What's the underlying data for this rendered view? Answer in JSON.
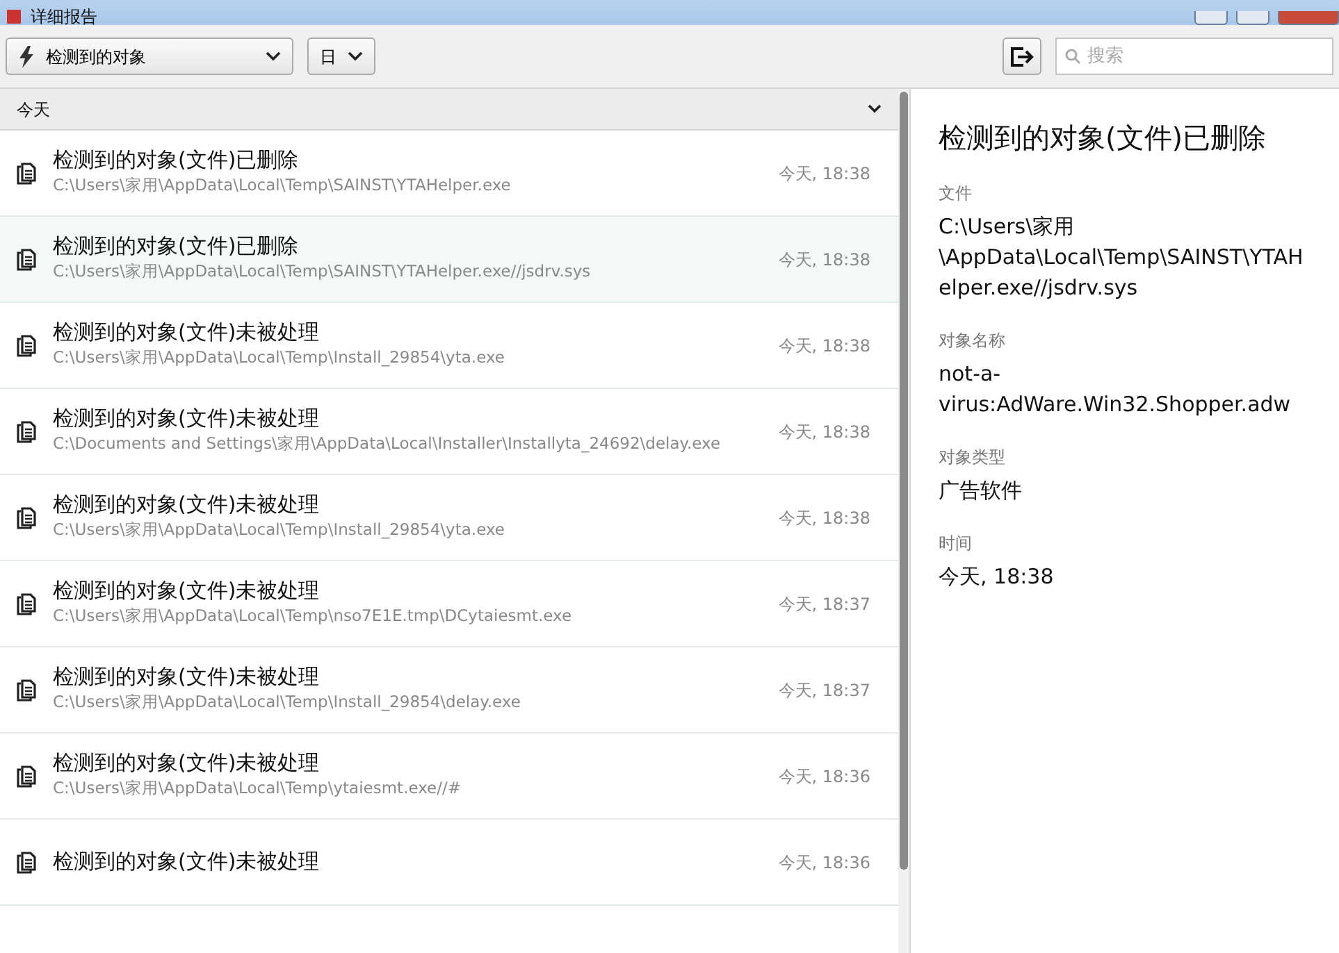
{
  "window": {
    "title": "详细报告"
  },
  "toolbar": {
    "filter": "检测到的对象",
    "period": "日",
    "search": {
      "placeholder": "搜索"
    }
  },
  "list": {
    "group": "今天",
    "expanded": true,
    "items": [
      {
        "title": "检测到的对象(文件)已删除",
        "path": "C:\\Users\\家用\\AppData\\Local\\Temp\\SAINST\\YTAHelper.exe",
        "time": "今天, 18:38",
        "selected": false
      },
      {
        "title": "检测到的对象(文件)已删除",
        "path": "C:\\Users\\家用\\AppData\\Local\\Temp\\SAINST\\YTAHelper.exe//jsdrv.sys",
        "time": "今天, 18:38",
        "selected": true
      },
      {
        "title": "检测到的对象(文件)未被处理",
        "path": "C:\\Users\\家用\\AppData\\Local\\Temp\\Install_29854\\yta.exe",
        "time": "今天, 18:38",
        "selected": false
      },
      {
        "title": "检测到的对象(文件)未被处理",
        "path": "C:\\Documents and Settings\\家用\\AppData\\Local\\Installer\\Installyta_24692\\delay.exe",
        "time": "今天, 18:38",
        "selected": false
      },
      {
        "title": "检测到的对象(文件)未被处理",
        "path": "C:\\Users\\家用\\AppData\\Local\\Temp\\Install_29854\\yta.exe",
        "time": "今天, 18:38",
        "selected": false
      },
      {
        "title": "检测到的对象(文件)未被处理",
        "path": "C:\\Users\\家用\\AppData\\Local\\Temp\\nso7E1E.tmp\\DCytaiesmt.exe",
        "time": "今天, 18:37",
        "selected": false
      },
      {
        "title": "检测到的对象(文件)未被处理",
        "path": "C:\\Users\\家用\\AppData\\Local\\Temp\\Install_29854\\delay.exe",
        "time": "今天, 18:37",
        "selected": false
      },
      {
        "title": "检测到的对象(文件)未被处理",
        "path": "C:\\Users\\家用\\AppData\\Local\\Temp\\ytaiesmt.exe//#",
        "time": "今天, 18:36",
        "selected": false
      },
      {
        "title": "检测到的对象(文件)未被处理",
        "time": "今天, 18:36",
        "selected": false
      }
    ]
  },
  "detail": {
    "title": "检测到的对象(文件)已删除",
    "fields": [
      {
        "label": "文件",
        "value": "C:\\Users\\家用\\AppData\\Local\\Temp\\SAINST\\YTAHelper.exe//jsdrv.sys"
      },
      {
        "label": "对象名称",
        "value": "not-a-virus:AdWare.Win32.Shopper.adw"
      },
      {
        "label": "对象类型",
        "value": "广告软件"
      },
      {
        "label": "时间",
        "value": "今天, 18:38"
      }
    ]
  }
}
